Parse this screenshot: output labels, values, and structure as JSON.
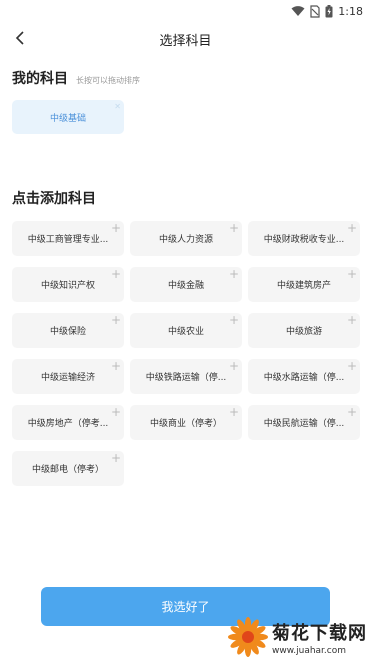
{
  "status_bar": {
    "time": "1:18"
  },
  "nav": {
    "title": "选择科目"
  },
  "my_subjects": {
    "title": "我的科目",
    "hint": "长按可以拖动排序",
    "items": [
      {
        "label": "中级基础"
      }
    ]
  },
  "add_section": {
    "title": "点击添加科目",
    "items": [
      {
        "label": "中级工商管理专业..."
      },
      {
        "label": "中级人力资源"
      },
      {
        "label": "中级财政税收专业..."
      },
      {
        "label": "中级知识产权"
      },
      {
        "label": "中级金融"
      },
      {
        "label": "中级建筑房产"
      },
      {
        "label": "中级保险"
      },
      {
        "label": "中级农业"
      },
      {
        "label": "中级旅游"
      },
      {
        "label": "中级运输经济"
      },
      {
        "label": "中级铁路运输（停..."
      },
      {
        "label": "中级水路运输（停..."
      },
      {
        "label": "中级房地产（停考..."
      },
      {
        "label": "中级商业（停考）"
      },
      {
        "label": "中级民航运输（停..."
      },
      {
        "label": "中级邮电（停考）"
      }
    ]
  },
  "done_button": {
    "label": "我选好了"
  },
  "watermark": {
    "name": "菊花下载网",
    "url": "www.juahar.com"
  },
  "colors": {
    "accent": "#4ca6ee",
    "chip_selected_bg": "#e8f3fc",
    "chip_bg": "#f5f5f5"
  },
  "icons": {
    "back": "chevron-left-icon",
    "add": "plus-icon",
    "remove": "close-icon"
  }
}
